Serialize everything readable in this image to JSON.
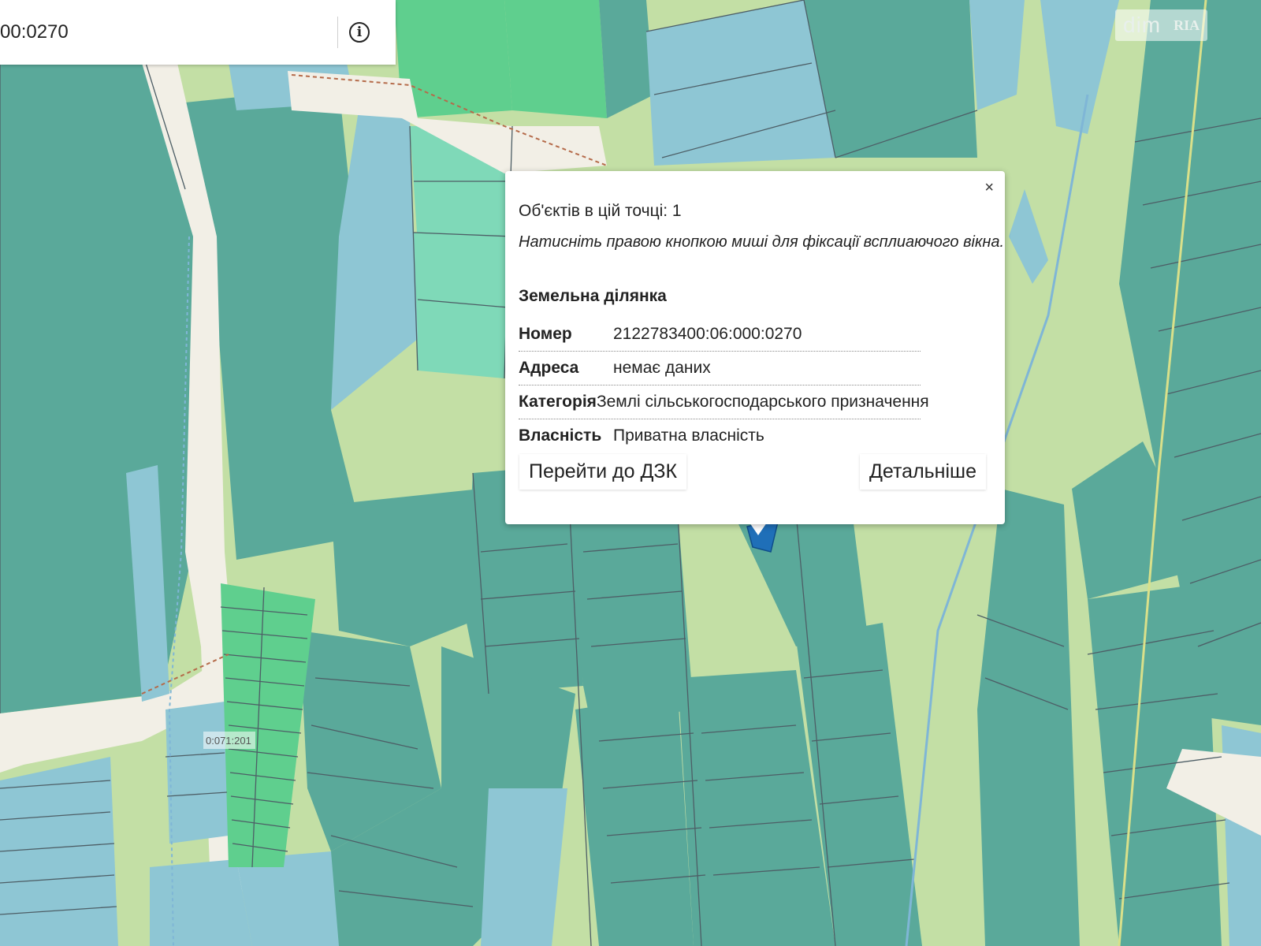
{
  "search": {
    "value": "00:0270"
  },
  "info_icon": {
    "name": "info-icon",
    "glyph": "i"
  },
  "watermark": {
    "text": "dim",
    "brand": "RIA"
  },
  "map": {
    "colors": {
      "land_teal": "#5aa99a",
      "land_blue": "#8ec6d4",
      "land_green": "#5fcf8e",
      "land_light_green": "#c3dfa5",
      "road": "#f2efe6",
      "parcel_outline": "#4d5e66",
      "selected_parcel": "#1f6fb8",
      "boundary": "#b56b4a"
    },
    "label": "0:071:201"
  },
  "popup": {
    "count_text": "Об'єктів в цій точці: 1",
    "hint_text": "Натисніть правою кнопкою миші для фіксації всплиаючого вікна.",
    "close_label": "×",
    "heading": "Земельна ділянка",
    "rows": [
      {
        "key": "Номер",
        "value": "2122783400:06:000:0270"
      },
      {
        "key": "Адреса",
        "value": "немає даних"
      },
      {
        "key": "Категорія",
        "value": "Землі сільськогосподарського призначення"
      },
      {
        "key": "Власність",
        "value": "Приватна власність"
      }
    ],
    "btn_dzk": "Перейти до ДЗК",
    "btn_details": "Детальніше"
  }
}
